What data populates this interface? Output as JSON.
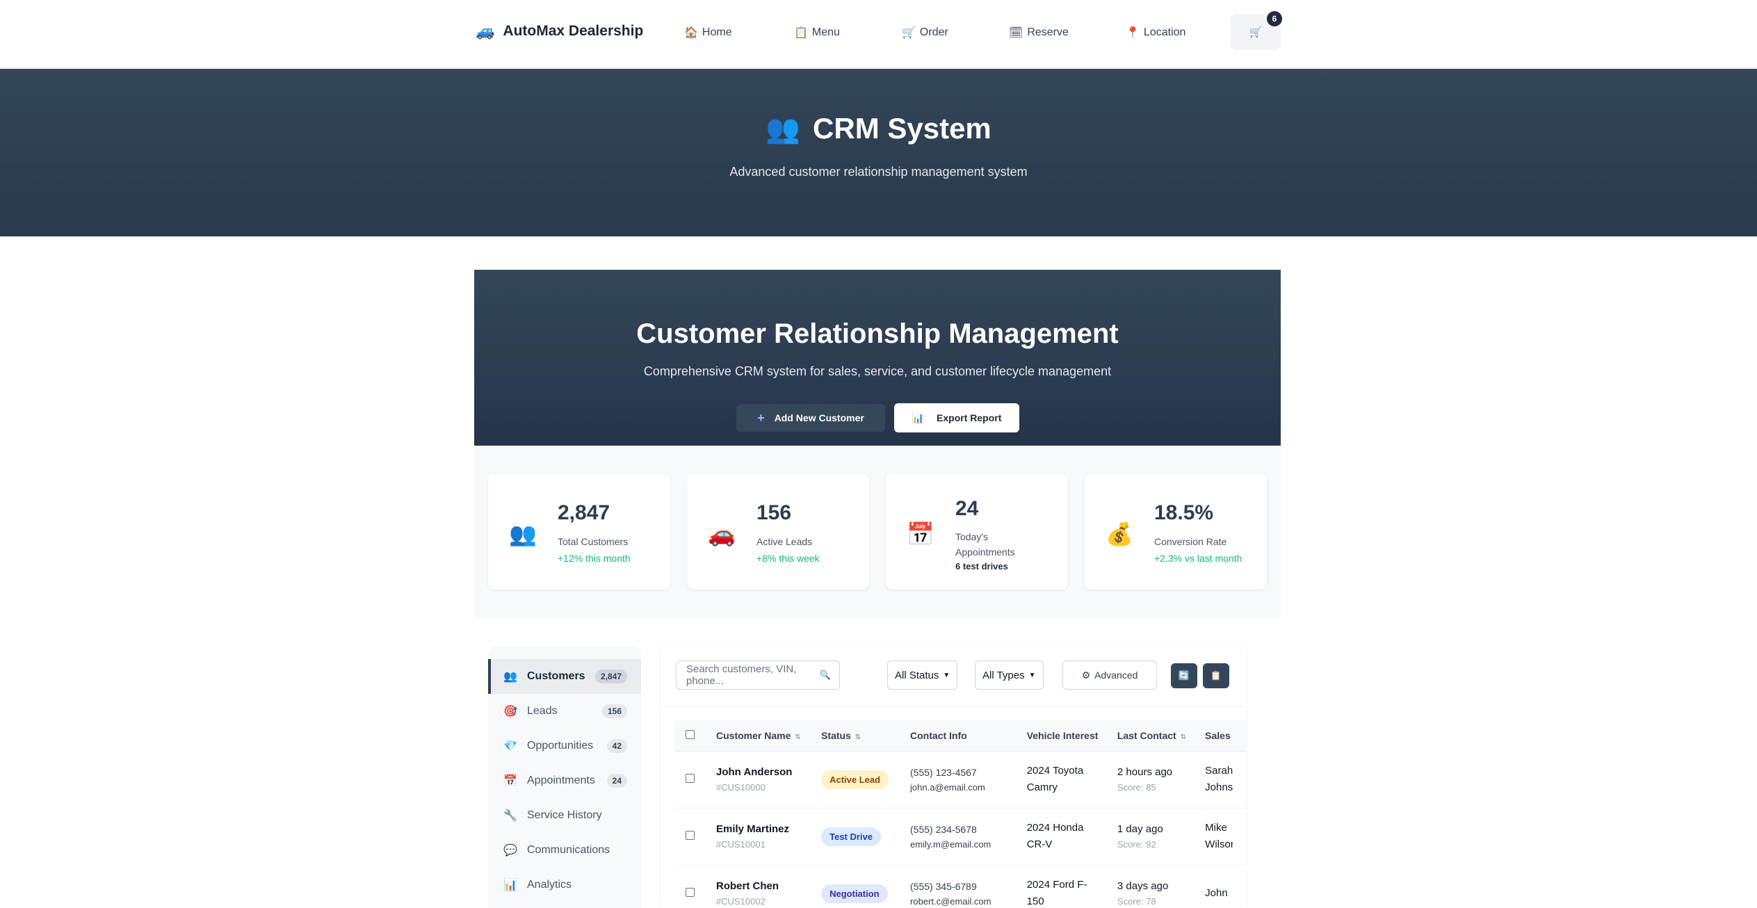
{
  "nav": {
    "brand": "AutoMax Dealership",
    "brand_icon": "🚙",
    "links": [
      {
        "icon": "🏠",
        "label": "Home"
      },
      {
        "icon": "📋",
        "label": "Menu"
      },
      {
        "icon": "🛒",
        "label": "Order"
      },
      {
        "icon": "🗓",
        "label": "Reserve"
      },
      {
        "icon": "📍",
        "label": "Location"
      }
    ],
    "cart_icon": "🛒",
    "cart_count": "6"
  },
  "hero": {
    "icon": "👥",
    "title": "CRM System",
    "subtitle": "Advanced customer relationship management system"
  },
  "crm_header": {
    "title": "Customer Relationship Management",
    "subtitle": "Comprehensive CRM system for sales, service, and customer lifecycle management",
    "add_icon": "+",
    "add_label": "Add New Customer",
    "export_icon": "📊",
    "export_label": "Export Report"
  },
  "stats": [
    {
      "icon": "👥",
      "value": "2,847",
      "label": "Total Customers",
      "change": "+12% this month"
    },
    {
      "icon": "🚗",
      "value": "156",
      "label": "Active Leads",
      "change": "+8% this week"
    },
    {
      "icon": "📅",
      "value": "24",
      "label": "Today's Appointments",
      "change": "6 test drives"
    },
    {
      "icon": "💰",
      "value": "18.5%",
      "label": "Conversion Rate",
      "change": "+2.3% vs last month"
    }
  ],
  "sidebar": {
    "items": [
      {
        "icon": "👥",
        "label": "Customers",
        "count": "2,847"
      },
      {
        "icon": "🎯",
        "label": "Leads",
        "count": "156"
      },
      {
        "icon": "💎",
        "label": "Opportunities",
        "count": "42"
      },
      {
        "icon": "📅",
        "label": "Appointments",
        "count": "24"
      },
      {
        "icon": "🔧",
        "label": "Service History",
        "count": ""
      },
      {
        "icon": "💬",
        "label": "Communications",
        "count": ""
      },
      {
        "icon": "📊",
        "label": "Analytics",
        "count": ""
      }
    ]
  },
  "toolbar": {
    "search_placeholder": "Search customers, VIN, phone...",
    "search_icon": "🔍",
    "status_filter": "All Status",
    "type_filter": "All Types",
    "advanced_icon": "⚙",
    "advanced_label": "Advanced",
    "refresh_icon": "🔄",
    "clipboard_icon": "📋"
  },
  "table": {
    "headers": {
      "name": "Customer Name",
      "status": "Status",
      "contact": "Contact Info",
      "vehicle": "Vehicle Interest",
      "last": "Last Contact",
      "sales": "Sales"
    },
    "rows": [
      {
        "name": "John Anderson",
        "id": "#CUS10000",
        "status": "Active Lead",
        "phone": "(555) 123-4567",
        "email": "john.a@email.com",
        "vehicle": "2024 Toyota Camry",
        "last": "2 hours ago",
        "score": "Score: 85",
        "sales": "Sarah Johnson"
      },
      {
        "name": "Emily Martinez",
        "id": "#CUS10001",
        "status": "Test Drive",
        "phone": "(555) 234-5678",
        "email": "emily.m@email.com",
        "vehicle": "2024 Honda CR-V",
        "last": "1 day ago",
        "score": "Score: 92",
        "sales": "Mike Wilson"
      },
      {
        "name": "Robert Chen",
        "id": "#CUS10002",
        "status": "Negotiation",
        "phone": "(555) 345-6789",
        "email": "robert.c@email.com",
        "vehicle": "2024 Ford F-150",
        "last": "3 days ago",
        "score": "Score: 78",
        "sales": "John"
      }
    ]
  },
  "colors": {
    "header_bg": "#2c3e50",
    "positive": "#10b981",
    "accent": "#34465a"
  }
}
